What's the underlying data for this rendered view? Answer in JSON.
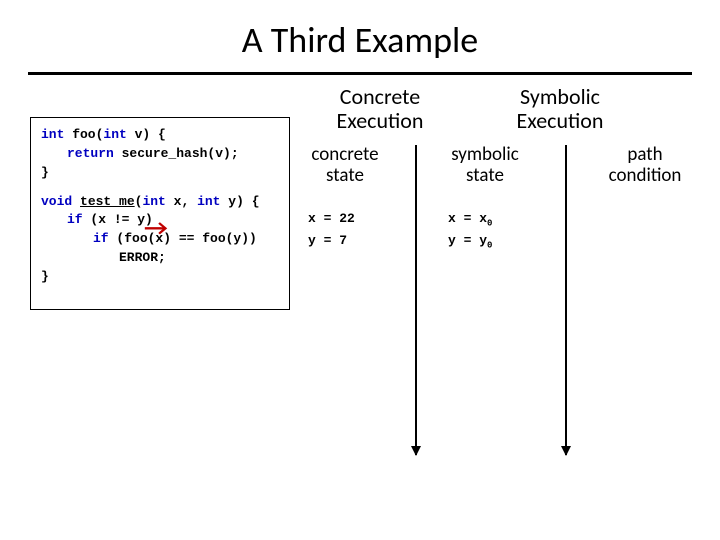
{
  "title": "A Third Example",
  "code": {
    "l1a": "int",
    "l1b": " foo(",
    "l1c": "int",
    "l1d": " v) {",
    "l2a": "return",
    "l2b": " secure_hash(v);",
    "l3": "}",
    "l4a": "void",
    "l4b": " ",
    "l4c": "test_me",
    "l4d": "(",
    "l4e": "int",
    "l4f": " x, ",
    "l4g": "int",
    "l4h": " y) {",
    "l5a": "if",
    "l5b": " (x != y)",
    "l6a": "if",
    "l6b": " (foo(x) == foo(y))",
    "l7": "ERROR;",
    "l8": "}"
  },
  "headers": {
    "concrete": "Concrete Execution",
    "symbolic": "Symbolic Execution",
    "cstate": "concrete state",
    "sstate": "symbolic state",
    "pathcond": "path condition"
  },
  "concrete": {
    "x": "x = 22",
    "y": "y = 7"
  },
  "symbolic": {
    "xa": "x = x",
    "xb": "0",
    "ya": "y = y",
    "yb": "0"
  }
}
